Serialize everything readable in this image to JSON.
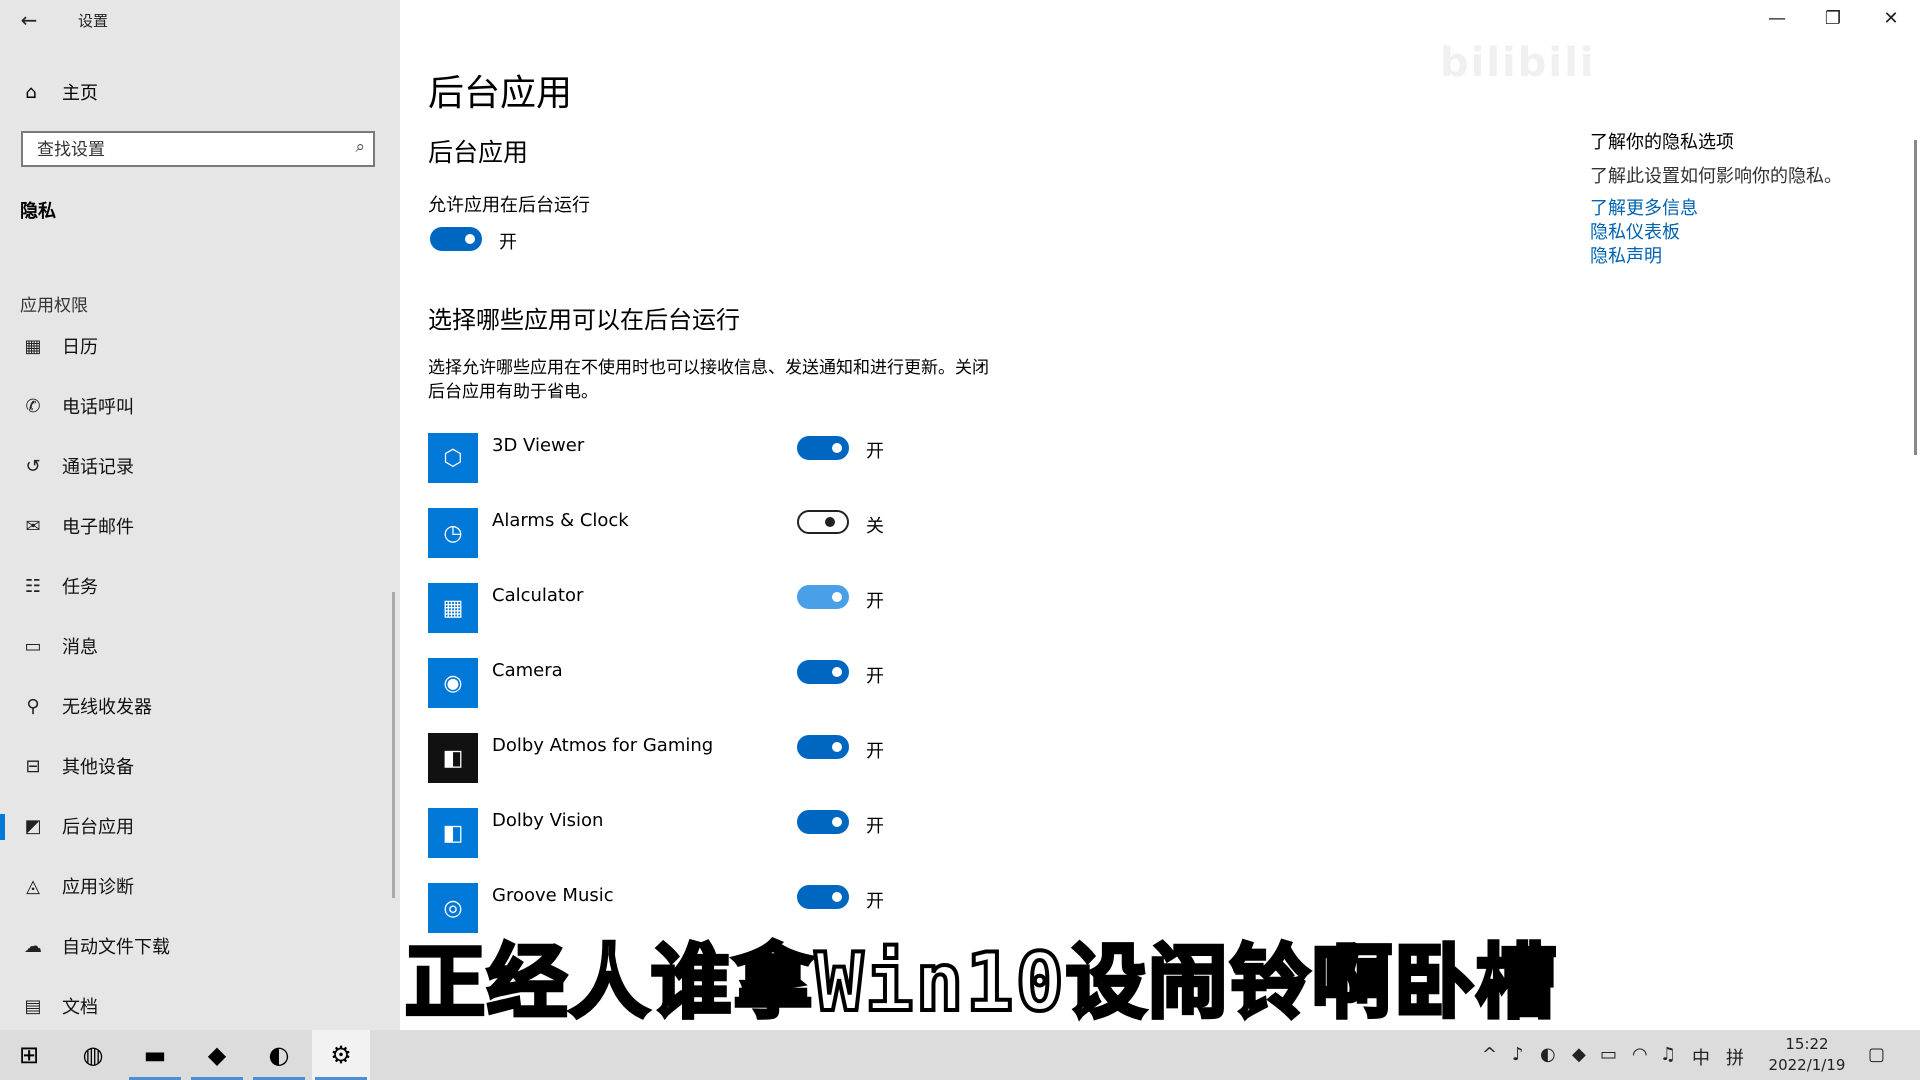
{
  "window": {
    "title": "设置"
  },
  "sidebar": {
    "home_label": "主页",
    "search_placeholder": "查找设置",
    "section": "隐私",
    "group": "应用权限",
    "items": [
      {
        "label": "日历",
        "icon": "calendar-icon"
      },
      {
        "label": "电话呼叫",
        "icon": "phone-icon"
      },
      {
        "label": "通话记录",
        "icon": "history-icon"
      },
      {
        "label": "电子邮件",
        "icon": "mail-icon"
      },
      {
        "label": "任务",
        "icon": "tasks-icon"
      },
      {
        "label": "消息",
        "icon": "message-icon"
      },
      {
        "label": "无线收发器",
        "icon": "radio-icon"
      },
      {
        "label": "其他设备",
        "icon": "devices-icon"
      },
      {
        "label": "后台应用",
        "icon": "background-apps-icon",
        "active": true
      },
      {
        "label": "应用诊断",
        "icon": "diagnostics-icon"
      },
      {
        "label": "自动文件下载",
        "icon": "cloud-icon"
      },
      {
        "label": "文档",
        "icon": "document-icon"
      }
    ]
  },
  "main": {
    "page_title": "后台应用",
    "section_title": "后台应用",
    "allow_label": "允许应用在后台运行",
    "allow_state": "开",
    "choose_title": "选择哪些应用可以在后台运行",
    "choose_desc": "选择允许哪些应用在不使用时也可以接收信息、发送通知和进行更新。关闭后台应用有助于省电。",
    "apps": [
      {
        "name": "3D Viewer",
        "state": "开",
        "on": true,
        "icon": "cube-icon",
        "color": "#0078d7"
      },
      {
        "name": "Alarms & Clock",
        "state": "关",
        "on": false,
        "icon": "clock-icon",
        "color": "#0078d7"
      },
      {
        "name": "Calculator",
        "state": "开",
        "on": true,
        "icon": "calculator-icon",
        "color": "#0078d7"
      },
      {
        "name": "Camera",
        "state": "开",
        "on": true,
        "icon": "camera-icon",
        "color": "#0078d7"
      },
      {
        "name": "Dolby Atmos for Gaming",
        "state": "开",
        "on": true,
        "icon": "dolby-icon",
        "color": "#111111"
      },
      {
        "name": "Dolby Vision",
        "state": "开",
        "on": true,
        "icon": "dolby-vision-icon",
        "color": "#0078d7"
      },
      {
        "name": "Groove Music",
        "state": "开",
        "on": true,
        "icon": "groove-icon",
        "color": "#0078d7"
      }
    ]
  },
  "right": {
    "title": "了解你的隐私选项",
    "desc": "了解此设置如何影响你的隐私。",
    "links": [
      "了解更多信息",
      "隐私仪表板",
      "隐私声明"
    ]
  },
  "subtitle": "正经人谁拿Win10设闹铃啊卧槽",
  "watermark": "bilibili",
  "taskbar": {
    "ime": "中",
    "ime2": "拼",
    "time": "15:22",
    "date": "2022/1/19"
  },
  "colors": {
    "accent": "#0078d7",
    "link": "#0063b1"
  }
}
